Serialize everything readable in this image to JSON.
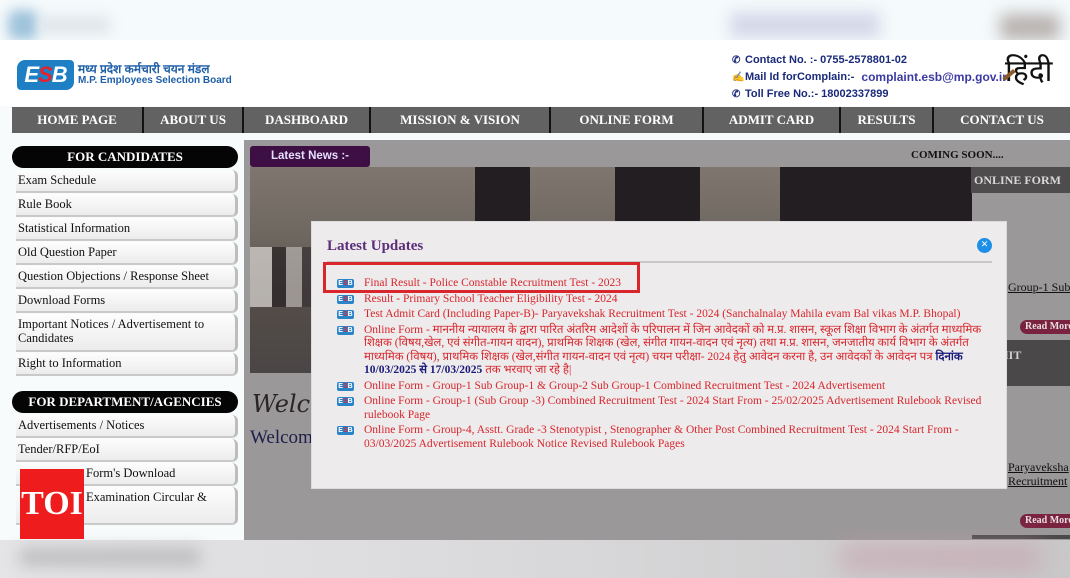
{
  "header": {
    "logo_mark": "ESB",
    "logo_hindi": "मध्य प्रदेश कर्मचारी चयन मंडल",
    "logo_english": "M.P. Employees Selection Board",
    "contact_label": "Contact No. :- 0755-2578801-02",
    "mail_label": "Mail Id forComplain:-",
    "mail_value": "complaint.esb@mp.gov.in",
    "tollfree_label": "Toll Free No.:- 18002337899",
    "language_link": "हिंदी"
  },
  "nav": [
    {
      "label": "HOME PAGE"
    },
    {
      "label": "ABOUT US"
    },
    {
      "label": "DASHBOARD"
    },
    {
      "label": "MISSION & VISION"
    },
    {
      "label": "ONLINE FORM"
    },
    {
      "label": "ADMIT CARD"
    },
    {
      "label": "RESULTS"
    },
    {
      "label": "CONTACT US"
    }
  ],
  "sidebar": {
    "candidates_heading": "FOR CANDIDATES",
    "candidates": [
      "Exam Schedule",
      "Rule Book",
      "Statistical Information",
      "Old Question Paper",
      "Question Objections / Response Sheet",
      "Download Forms",
      "Important Notices / Advertisement to Candidates",
      "Right to Information"
    ],
    "department_heading": "FOR DEPARTMENT/AGENCIES",
    "department": [
      "Advertisements / Notices",
      "Tender/RFP/EoI",
      "Form's Download",
      "Examination Circular &"
    ]
  },
  "content": {
    "latest_news": "Latest News :-",
    "coming_soon": "COMING SOON....",
    "online_form_panel": "ONLINE FORM",
    "online_form_link": "Group-1 Sub",
    "read_more": "Read More",
    "admit_panel": "ADMIT",
    "admit_link_line1": "Paryaveksha",
    "admit_link_line2": "Recruitment",
    "welcome_script": "Welco",
    "welcome_text": "Welcom"
  },
  "modal": {
    "title": "Latest Updates",
    "close_icon": "close-icon",
    "updates": [
      {
        "text": "Final Result - Police Constable Recruitment Test - 2023",
        "highlighted": true
      },
      {
        "text": "Result - Primary School Teacher Eligibility Test - 2024"
      },
      {
        "text": "Test Admit Card  (Including Paper-B)- Paryavekshak Recruitment Test - 2024 (Sanchalnalay Mahila evam Bal vikas M.P. Bhopal)"
      },
      {
        "text": "Online Form  - माननीय न्यायालय के द्वारा पारित अंतरिम आदेशों के परिपालन में जिन आवेदकों को म.प्र. शासन, स्कूल शिक्षा विभाग के अंतर्गत माध्यमिक शिक्षक (विषय,खेल, एवं संगीत-गायन वादन), प्राथमिक शिक्षक (खेल, संगीत गायन-वादन एवं नृत्य) तथा म.प्र. शासन, जनजातीय कार्य विभाग के अंतर्गत माध्यमिक (विषय), प्राथमिक शिक्षक (खेल,संगीत गायन-वादन एवं नृत्य) चयन परीक्षा- 2024 हेतु आवेदन करना है, उन आवेदकों के आवेदन पत्र",
        "highlight_text": "दिनांक 10/03/2025 से 17/03/2025",
        "suffix": "तक भरवाए जा रहे है|"
      },
      {
        "text": "Online Form - Group-1 Sub Group-1 & Group-2 Sub Group-1 Combined Recruitment Test - 2024  Advertisement"
      },
      {
        "text": "Online Form - Group-1 (Sub Group -3) Combined Recruitment Test - 2024 Start From - 25/02/2025 Advertisement   Rulebook    Revised rulebook Page"
      },
      {
        "text": "Online Form - Group-4, Asstt. Grade -3 Stenotypist , Stenographer & Other Post Combined Recruitment Test - 2024 Start From - 03/03/2025  Advertisement     Rulebook    Notice    Revised Rulebook Pages"
      }
    ]
  },
  "watermark": "TOI"
}
